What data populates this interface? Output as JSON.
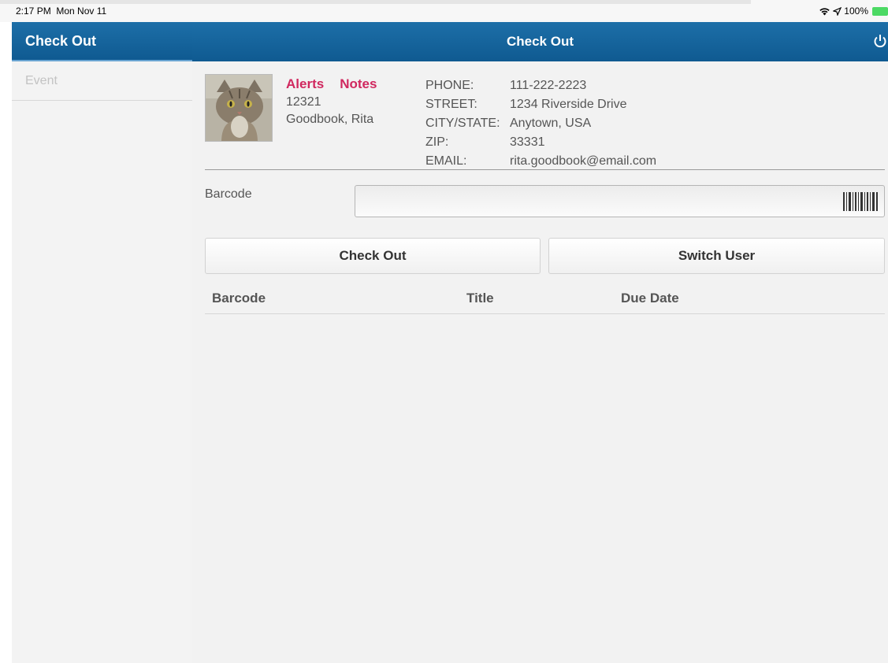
{
  "status_bar": {
    "time": "2:17 PM",
    "date": "Mon Nov 11",
    "battery": "100%",
    "icons": [
      "wifi-icon",
      "location-icon",
      "battery-icon"
    ]
  },
  "sidebar": {
    "header": "Check Out",
    "items": [
      {
        "label": "Event"
      }
    ]
  },
  "header": {
    "title": "Check Out",
    "power_icon": "power-icon"
  },
  "patron": {
    "alerts_label": "Alerts",
    "notes_label": "Notes",
    "id": "12321",
    "name": "Goodbook, Rita",
    "photo": "cat-photo"
  },
  "contact": [
    {
      "key": "PHONE:",
      "value": "111-222-2223"
    },
    {
      "key": "STREET:",
      "value": "1234 Riverside Drive"
    },
    {
      "key": "CITY/STATE:",
      "value": "Anytown, USA"
    },
    {
      "key": "ZIP:",
      "value": "33331"
    },
    {
      "key": "EMAIL:",
      "value": "rita.goodbook@email.com"
    }
  ],
  "barcode": {
    "label": "Barcode",
    "value": "",
    "icon": "barcode-scan-icon"
  },
  "buttons": {
    "check_out": "Check Out",
    "switch_user": "Switch User"
  },
  "table": {
    "columns": [
      "Barcode",
      "Title",
      "Due Date"
    ],
    "rows": []
  },
  "colors": {
    "header_blue": "#1565a0",
    "accent_pink": "#d0285f"
  }
}
